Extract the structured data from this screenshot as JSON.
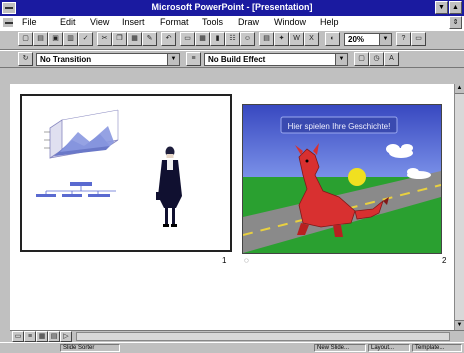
{
  "window": {
    "title": "Microsoft PowerPoint - [Presentation]",
    "minimize_glyph": "▼",
    "maximize_glyph": "▲",
    "restore_glyph": "⇕"
  },
  "menu": {
    "items": [
      "File",
      "Edit",
      "View",
      "Insert",
      "Format",
      "Tools",
      "Draw",
      "Window",
      "Help"
    ]
  },
  "toolbar": {
    "zoom_value": "20%"
  },
  "transition_bar": {
    "transition_value": "No Transition",
    "build_value": "No Build Effect"
  },
  "slides": [
    {
      "number": "1"
    },
    {
      "number": "2",
      "title": "Hier spielen Ihre Geschichte!"
    }
  ],
  "status": {
    "left": "Slide Sorter",
    "middle": "New Slide...",
    "layout": "Layout...",
    "template": "Template..."
  },
  "colors": {
    "titlebar": "#1a1aa0",
    "sky": "#4a5fd0",
    "grass": "#2aa030",
    "road": "#9a9a9a",
    "dragon": "#d83030"
  }
}
